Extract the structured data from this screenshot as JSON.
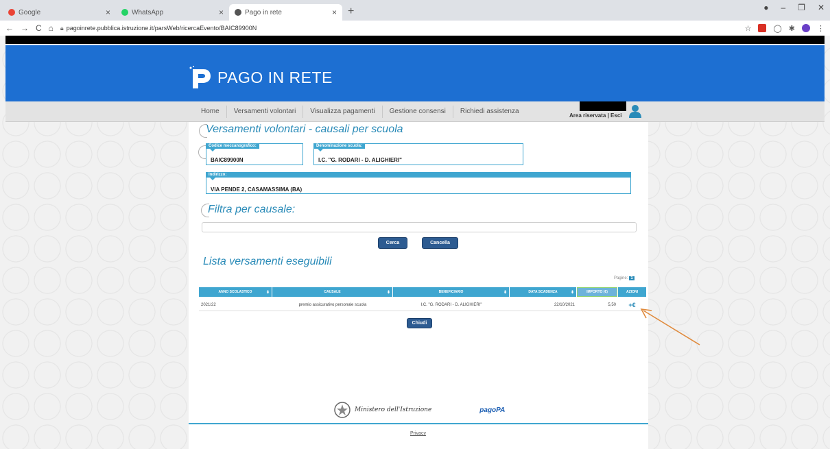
{
  "browser": {
    "tabs": [
      {
        "label": "Google",
        "favicon_color": "#ea4335"
      },
      {
        "label": "WhatsApp",
        "favicon_color": "#25d366"
      },
      {
        "label": "Pago in rete",
        "favicon_color": "#555555"
      }
    ],
    "new_tab": "+",
    "url": "pagoinrete.pubblica.istruzione.it/parsWeb/ricercaEvento/BAIC89900N"
  },
  "site": {
    "logo_text": "PAGO IN RETE",
    "nav": [
      "Home",
      "Versamenti volontari",
      "Visualizza pagamenti",
      "Gestione consensi",
      "Richiedi assistenza"
    ],
    "area_link": "Area riservata | Esci",
    "colors": {
      "header": "#1d6fd2",
      "accent": "#3fa6d0",
      "button": "#2d5b91"
    }
  },
  "main": {
    "title": "Versamenti volontari - causali per scuola",
    "codice_label": "Codice meccanografico:",
    "codice_value": "BAIC89900N",
    "denominazione_label": "Denominazione scuola:",
    "denominazione_value": "I.C. \"G. RODARI - D. ALIGHIERI\"",
    "indirizzo_label": "Indirizzo:",
    "indirizzo_value": "VIA PENDE 2, CASAMASSIMA (BA)",
    "filter_title": "Filtra per causale:",
    "filter_value": "",
    "cerca_label": "Cerca",
    "cancella_label": "Cancella",
    "list_title": "Lista versamenti eseguibili",
    "pagine_label": "Pagine:",
    "pagine_value": "1",
    "table": {
      "headers": [
        "ANNO SCOLASTICO",
        "CAUSALE",
        "BENEFICIARIO",
        "DATA SCADENZA",
        "IMPORTO (€)",
        "AZIONI"
      ],
      "rows": [
        {
          "anno": "2021/22",
          "causale": "premio assicurativo personale scuola",
          "beneficiario": "I.C. \"G. RODARI - D. ALIGHIERI\"",
          "scadenza": "22/10/2021",
          "importo": "5,50",
          "azione": "+€"
        }
      ]
    },
    "chiudi_label": "Chiudi"
  },
  "footer": {
    "ministero": "Ministero dell'Istruzione",
    "pagopa": "pagoPA",
    "privacy": "Privacy"
  }
}
